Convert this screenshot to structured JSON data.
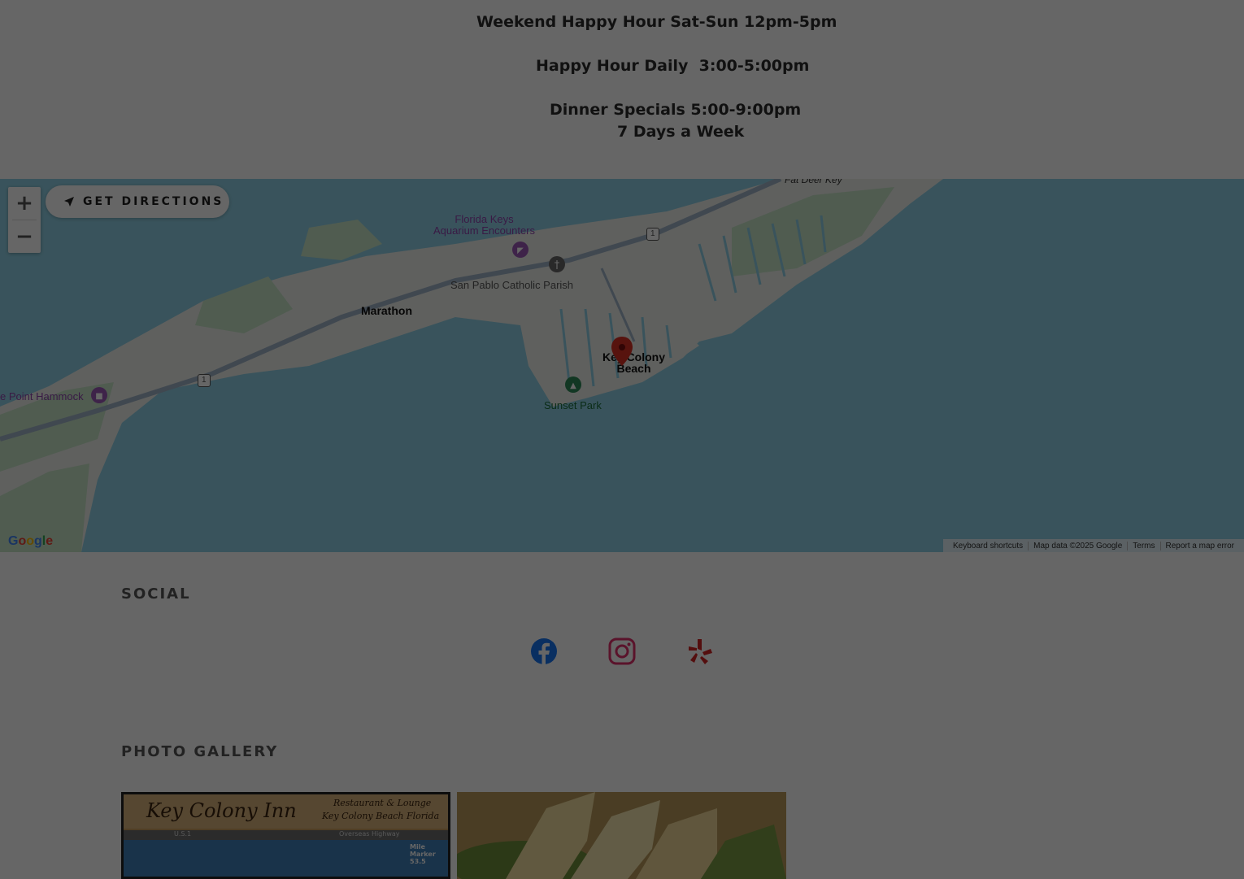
{
  "hours": {
    "line1": "Weekend Happy Hour Sat-Sun 12pm-5pm",
    "line2": "Happy Hour Daily  3:00-5:00pm",
    "line3": "Dinner Specials 5:00-9:00pm",
    "line4": "7 Days a Week"
  },
  "map": {
    "zoom_in": "+",
    "zoom_out": "−",
    "directions_label": "GET DIRECTIONS",
    "labels": {
      "fat_deer_key": "Fat Deer Key",
      "aquarium": "Florida Keys\nAquarium Encounters",
      "san_pablo": "San Pablo Catholic Parish",
      "marathon": "Marathon",
      "key_colony": "Key Colony\nBeach",
      "sunset_park": "Sunset Park",
      "point_hammock": "e Point Hammock",
      "route": "1"
    },
    "google_logo": "Google",
    "attribution": [
      "Keyboard shortcuts",
      "Map data ©2025 Google",
      "Terms",
      "Report a map error"
    ],
    "colors": {
      "water": "#8fd0e5",
      "land": "#eef0ec",
      "park": "#c8e6c9",
      "road": "#a0b4c8"
    }
  },
  "social": {
    "title": "SOCIAL",
    "icons": [
      "facebook-icon",
      "instagram-icon",
      "yelp-icon"
    ],
    "colors": {
      "facebook": "#1877f2",
      "instagram": "#e1306c",
      "yelp": "#d32323"
    }
  },
  "gallery": {
    "title": "PHOTO GALLERY",
    "photo1_text": {
      "title": "Key Colony Inn",
      "sub1": "Restaurant & Lounge",
      "sub2": "Key Colony Beach Florida",
      "road1": "U.S.1",
      "road2": "Overseas Highway",
      "marker": "Mile\nMarker\n53.5"
    }
  }
}
